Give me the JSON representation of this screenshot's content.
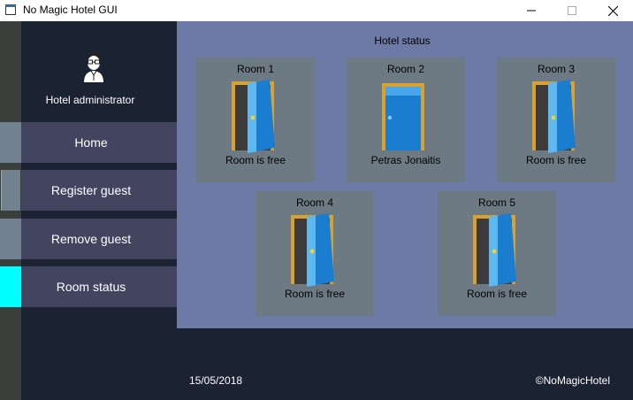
{
  "window": {
    "title": "No Magic Hotel GUI",
    "icon": "app-window-icon",
    "controls": [
      "minimize-icon",
      "maximize-icon",
      "close-icon"
    ]
  },
  "sidebar": {
    "admin_label": "Hotel administrator",
    "admin_icon": "admin-avatar-icon",
    "items": [
      {
        "label": "Home"
      },
      {
        "label": "Register guest"
      },
      {
        "label": "Remove guest"
      },
      {
        "label": "Room status",
        "active": true
      }
    ]
  },
  "main": {
    "title": "Hotel status",
    "rooms": [
      {
        "name": "Room 1",
        "status": "Room is free",
        "door": "open-door-icon"
      },
      {
        "name": "Room 2",
        "status": "Petras Jonaitis",
        "door": "closed-door-icon"
      },
      {
        "name": "Room 3",
        "status": "Room is free",
        "door": "open-door-icon"
      },
      {
        "name": "Room 4",
        "status": "Room is free",
        "door": "open-door-icon"
      },
      {
        "name": "Room 5",
        "status": "Room is free",
        "door": "open-door-icon"
      }
    ]
  },
  "footer": {
    "date": "15/05/2018",
    "copyright": "©NoMagicHotel"
  },
  "colors": {
    "background": "#1b2332",
    "nav_item": "#434560",
    "active_marker": "#00ffff",
    "content_bg": "#6e7aa6",
    "room_card": "#6d7a83",
    "door_frame": "#d9a130",
    "door_blue": "#1d86d6"
  }
}
